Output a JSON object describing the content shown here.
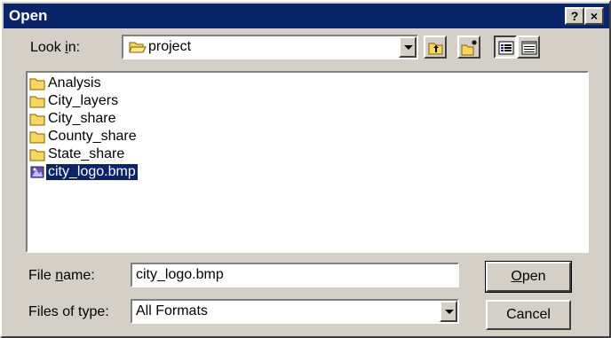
{
  "window": {
    "title": "Open",
    "help_label": "?",
    "close_label": "×"
  },
  "look_in": {
    "label_pre": "Look ",
    "label_ul": "i",
    "label_post": "n:",
    "value": "project"
  },
  "toolbar": [
    "up-one-level",
    "create-new-folder",
    "list-view",
    "details-view"
  ],
  "files": [
    {
      "name": "Analysis",
      "type": "folder"
    },
    {
      "name": "City_layers",
      "type": "folder"
    },
    {
      "name": "City_share",
      "type": "folder"
    },
    {
      "name": "County_share",
      "type": "folder"
    },
    {
      "name": "State_share",
      "type": "folder"
    },
    {
      "name": "city_logo.bmp",
      "type": "bitmap",
      "selected": true
    }
  ],
  "file_name": {
    "label_pre": "File ",
    "label_ul": "n",
    "label_post": "ame:",
    "value": "city_logo.bmp"
  },
  "file_type": {
    "label": "Files of type:",
    "value": "All Formats"
  },
  "buttons": {
    "open_ul": "O",
    "open_rest": "pen",
    "cancel": "Cancel"
  },
  "colors": {
    "titlebar": "#0a246a",
    "face": "#d4d0c8",
    "folder": "#f7d75f",
    "selection": "#0a246a"
  }
}
